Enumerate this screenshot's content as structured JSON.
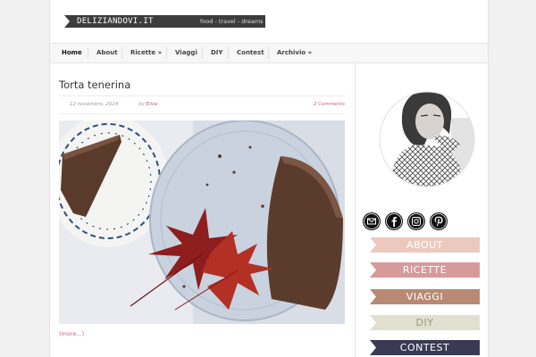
{
  "site": {
    "logo_text": "DELIZIANDOVI.IT",
    "tagline": "food - travel - dreams"
  },
  "nav": {
    "items": [
      {
        "label": "Home"
      },
      {
        "label": "About"
      },
      {
        "label": "Ricette »"
      },
      {
        "label": "Viaggi"
      },
      {
        "label": "DIY"
      },
      {
        "label": "Contest"
      },
      {
        "label": "Archivio »"
      }
    ]
  },
  "post": {
    "title": "Torta tenerina",
    "date": "12 novembre, 2014",
    "by_prefix": "by",
    "author": "Elisa",
    "comments": "2 Comments",
    "more_link": "(more...)"
  },
  "sidebar": {
    "social_icons": [
      "email-icon",
      "facebook-icon",
      "instagram-icon",
      "pinterest-icon"
    ],
    "banners": [
      {
        "label": "ABOUT",
        "color": "#ecc9bf"
      },
      {
        "label": "RICETTE",
        "color": "#d69a9b"
      },
      {
        "label": "VIAGGI",
        "color": "#b88a74"
      },
      {
        "label": "DIY",
        "color": "#e1dfcf"
      },
      {
        "label": "CONTEST",
        "color": "#3b3a55"
      }
    ]
  },
  "colors": {
    "accent": "#c0607f",
    "logo_bar": "#3c3c3c"
  }
}
